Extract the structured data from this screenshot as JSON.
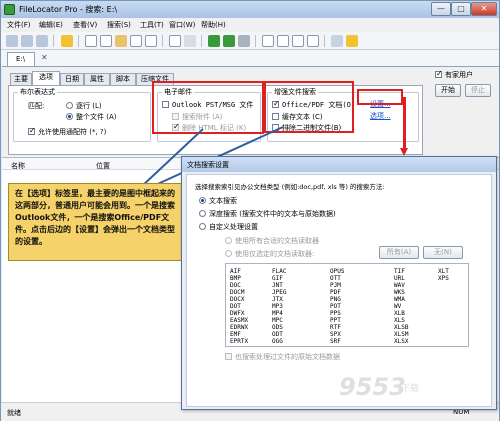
{
  "window": {
    "title": "FileLocator Pro - 搜索: E:\\",
    "min_glyph": "—",
    "max_glyph": "□",
    "close_glyph": "✕"
  },
  "menubar": {
    "items": [
      "文件(F)",
      "编辑(E)",
      "查看(V)",
      "搜索(S)",
      "工具(T)",
      "窗口(W)",
      "帮助(H)"
    ]
  },
  "doc_tab": {
    "label": "E:\\",
    "close_glyph": "✕"
  },
  "panel_tabs": [
    "主要",
    "选项",
    "日期",
    "属性",
    "脚本",
    "压缩文件"
  ],
  "options": {
    "group_expr_title": "布尔表达式",
    "match_label": "匹配:",
    "radio_line": "逐行 (L)",
    "radio_whole": "整个文件 (A)",
    "wildcards_label": "允许使用通配符 (*, ?)",
    "group_email_title": "电子邮件",
    "outlook_label": "Outlook PST/MSG 文件",
    "search_attach_label": "搜索附件 (A)",
    "strip_html_label": "删除 HTML 标记 (K)",
    "group_enhanced_title": "增强文件搜索",
    "office_label": "Office/PDF 文档(O)",
    "settings_link": "设置...",
    "cache_label": "缓存文本 (C)",
    "exclude_binary_label": "排除二进制文件(B)",
    "options_link": "选项...",
    "start_button": "开始",
    "stop_button": "停止",
    "favorite_label": "有家用户"
  },
  "results": {
    "col_name": "名称",
    "col_location": "位置"
  },
  "statusbar": {
    "status": "就绪",
    "num": "NUM"
  },
  "callout": {
    "text": "在【选项】标签里，最主要的是图中框起来的这两部分，普通用户可能会用到。一个是搜索Outlook文件，一个是搜索Office/PDF文件。点击后边的【设置】会弹出一个文档类型的设置。"
  },
  "dialog": {
    "title": "文档搜索设置",
    "prompt": "选择搜索索引见办公文档类型 (例如:doc,pdf, xls 等) 的搜索方法:",
    "radio_text": "文本搜索",
    "radio_deep": "深度搜索 (搜索文件中的文本与原始数据)",
    "radio_custom": "自定义处理设置",
    "sub_all": "使用所有合适的文档读取器",
    "sub_selected": "使用仅选定的文档读取器:",
    "btn_all": "所有(A)",
    "btn_none": "无(N)",
    "extensions": [
      [
        "AIF",
        "FLAC",
        "OPUS",
        "TIF",
        "XLT"
      ],
      [
        "BMP",
        "GIF",
        "OTT",
        "URL",
        "XPS"
      ],
      [
        "DOC",
        "JNT",
        "PJM",
        "WAV",
        ""
      ],
      [
        "DOCM",
        "JPEG",
        "PDF",
        "WKS",
        ""
      ],
      [
        "DOCX",
        "JTX",
        "PNG",
        "WMA",
        ""
      ],
      [
        "DOT",
        "MP3",
        "POT",
        "WV",
        ""
      ],
      [
        "DWFX",
        "MP4",
        "PPS",
        "XLB",
        ""
      ],
      [
        "EASMX",
        "MPC",
        "PPT",
        "XLS",
        ""
      ],
      [
        "EDRWX",
        "ODS",
        "RTF",
        "XLSB",
        ""
      ],
      [
        "EMF",
        "ODT",
        "SPX",
        "XLSM",
        ""
      ],
      [
        "EPRTX",
        "OGG",
        "SRF",
        "XLSX",
        ""
      ]
    ],
    "footer_check": "也搜索处理过文件的原始文档数据"
  },
  "watermark": {
    "main": "9553",
    "sub": "下载"
  }
}
